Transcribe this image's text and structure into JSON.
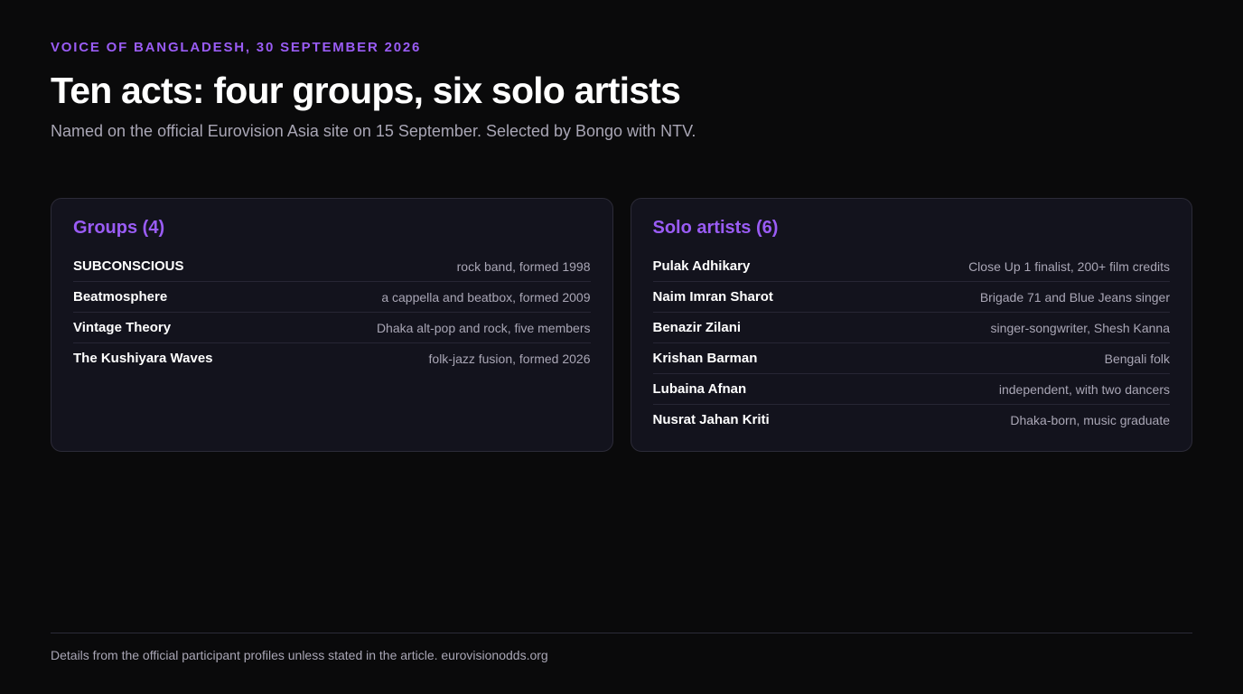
{
  "header": {
    "kicker": "VOICE OF BANGLADESH, 30 SEPTEMBER 2026",
    "title": "Ten acts: four groups, six solo artists",
    "subtitle": "Named on the official Eurovision Asia site on 15 September. Selected by Bongo with NTV."
  },
  "groups": {
    "title": "Groups (4)",
    "items": [
      {
        "name": "SUBCONSCIOUS",
        "desc": "rock band, formed 1998"
      },
      {
        "name": "Beatmosphere",
        "desc": "a cappella and beatbox, formed 2009"
      },
      {
        "name": "Vintage Theory",
        "desc": "Dhaka alt-pop and rock, five members"
      },
      {
        "name": "The Kushiyara Waves",
        "desc": "folk-jazz fusion, formed 2026"
      }
    ]
  },
  "solo": {
    "title": "Solo artists (6)",
    "items": [
      {
        "name": "Pulak Adhikary",
        "desc": "Close Up 1 finalist, 200+ film credits"
      },
      {
        "name": "Naim Imran Sharot",
        "desc": "Brigade 71 and Blue Jeans singer"
      },
      {
        "name": "Benazir Zilani",
        "desc": "singer-songwriter, Shesh Kanna"
      },
      {
        "name": "Krishan Barman",
        "desc": "Bengali folk"
      },
      {
        "name": "Lubaina Afnan",
        "desc": "independent, with two dancers"
      },
      {
        "name": "Nusrat Jahan Kriti",
        "desc": "Dhaka-born, music graduate"
      }
    ]
  },
  "footer": {
    "text": "Details from the official participant profiles unless stated in the article. eurovisionodds.org"
  },
  "colors": {
    "background": "#0a0a0b",
    "accent": "#9a5cf5",
    "card": "#13131d",
    "muted_text": "#a9a6b5"
  }
}
